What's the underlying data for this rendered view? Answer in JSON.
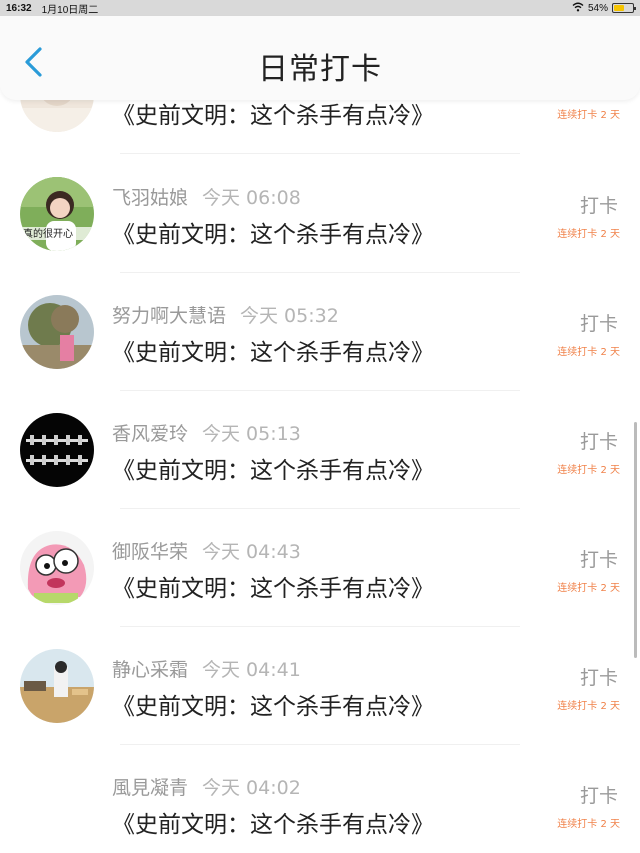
{
  "status_bar": {
    "time": "16:32",
    "date": "1月10日周二",
    "battery": "54%",
    "battery_level": 0.54
  },
  "header": {
    "title": "日常打卡",
    "back_icon": "chevron-left-icon"
  },
  "colors": {
    "accent": "#2a9bd8",
    "streak": "#f0824a",
    "text_muted": "#9a9a9a"
  },
  "rows": [
    {
      "name": "",
      "time": "",
      "work": "《史前文明：这个杀手有点冷》",
      "checkin": "",
      "streak": "连续打卡 2 天"
    },
    {
      "name": "飞羽姑娘",
      "time": "今天 06:08",
      "work": "《史前文明：这个杀手有点冷》",
      "checkin": "打卡",
      "streak": "连续打卡 2 天",
      "avatar_caption": "真的很开心"
    },
    {
      "name": "努力啊大慧语",
      "time": "今天 05:32",
      "work": "《史前文明：这个杀手有点冷》",
      "checkin": "打卡",
      "streak": "连续打卡 2 天"
    },
    {
      "name": "香风爱玲",
      "time": "今天 05:13",
      "work": "《史前文明：这个杀手有点冷》",
      "checkin": "打卡",
      "streak": "连续打卡 2 天"
    },
    {
      "name": "御阪华荣",
      "time": "今天 04:43",
      "work": "《史前文明：这个杀手有点冷》",
      "checkin": "打卡",
      "streak": "连续打卡 2 天"
    },
    {
      "name": "静心采霜",
      "time": "今天 04:41",
      "work": "《史前文明：这个杀手有点冷》",
      "checkin": "打卡",
      "streak": "连续打卡 2 天"
    },
    {
      "name": "風見凝青",
      "time": "今天 04:02",
      "work": "《史前文明：这个杀手有点冷》",
      "checkin": "打卡",
      "streak": "连续打卡 2 天"
    }
  ]
}
